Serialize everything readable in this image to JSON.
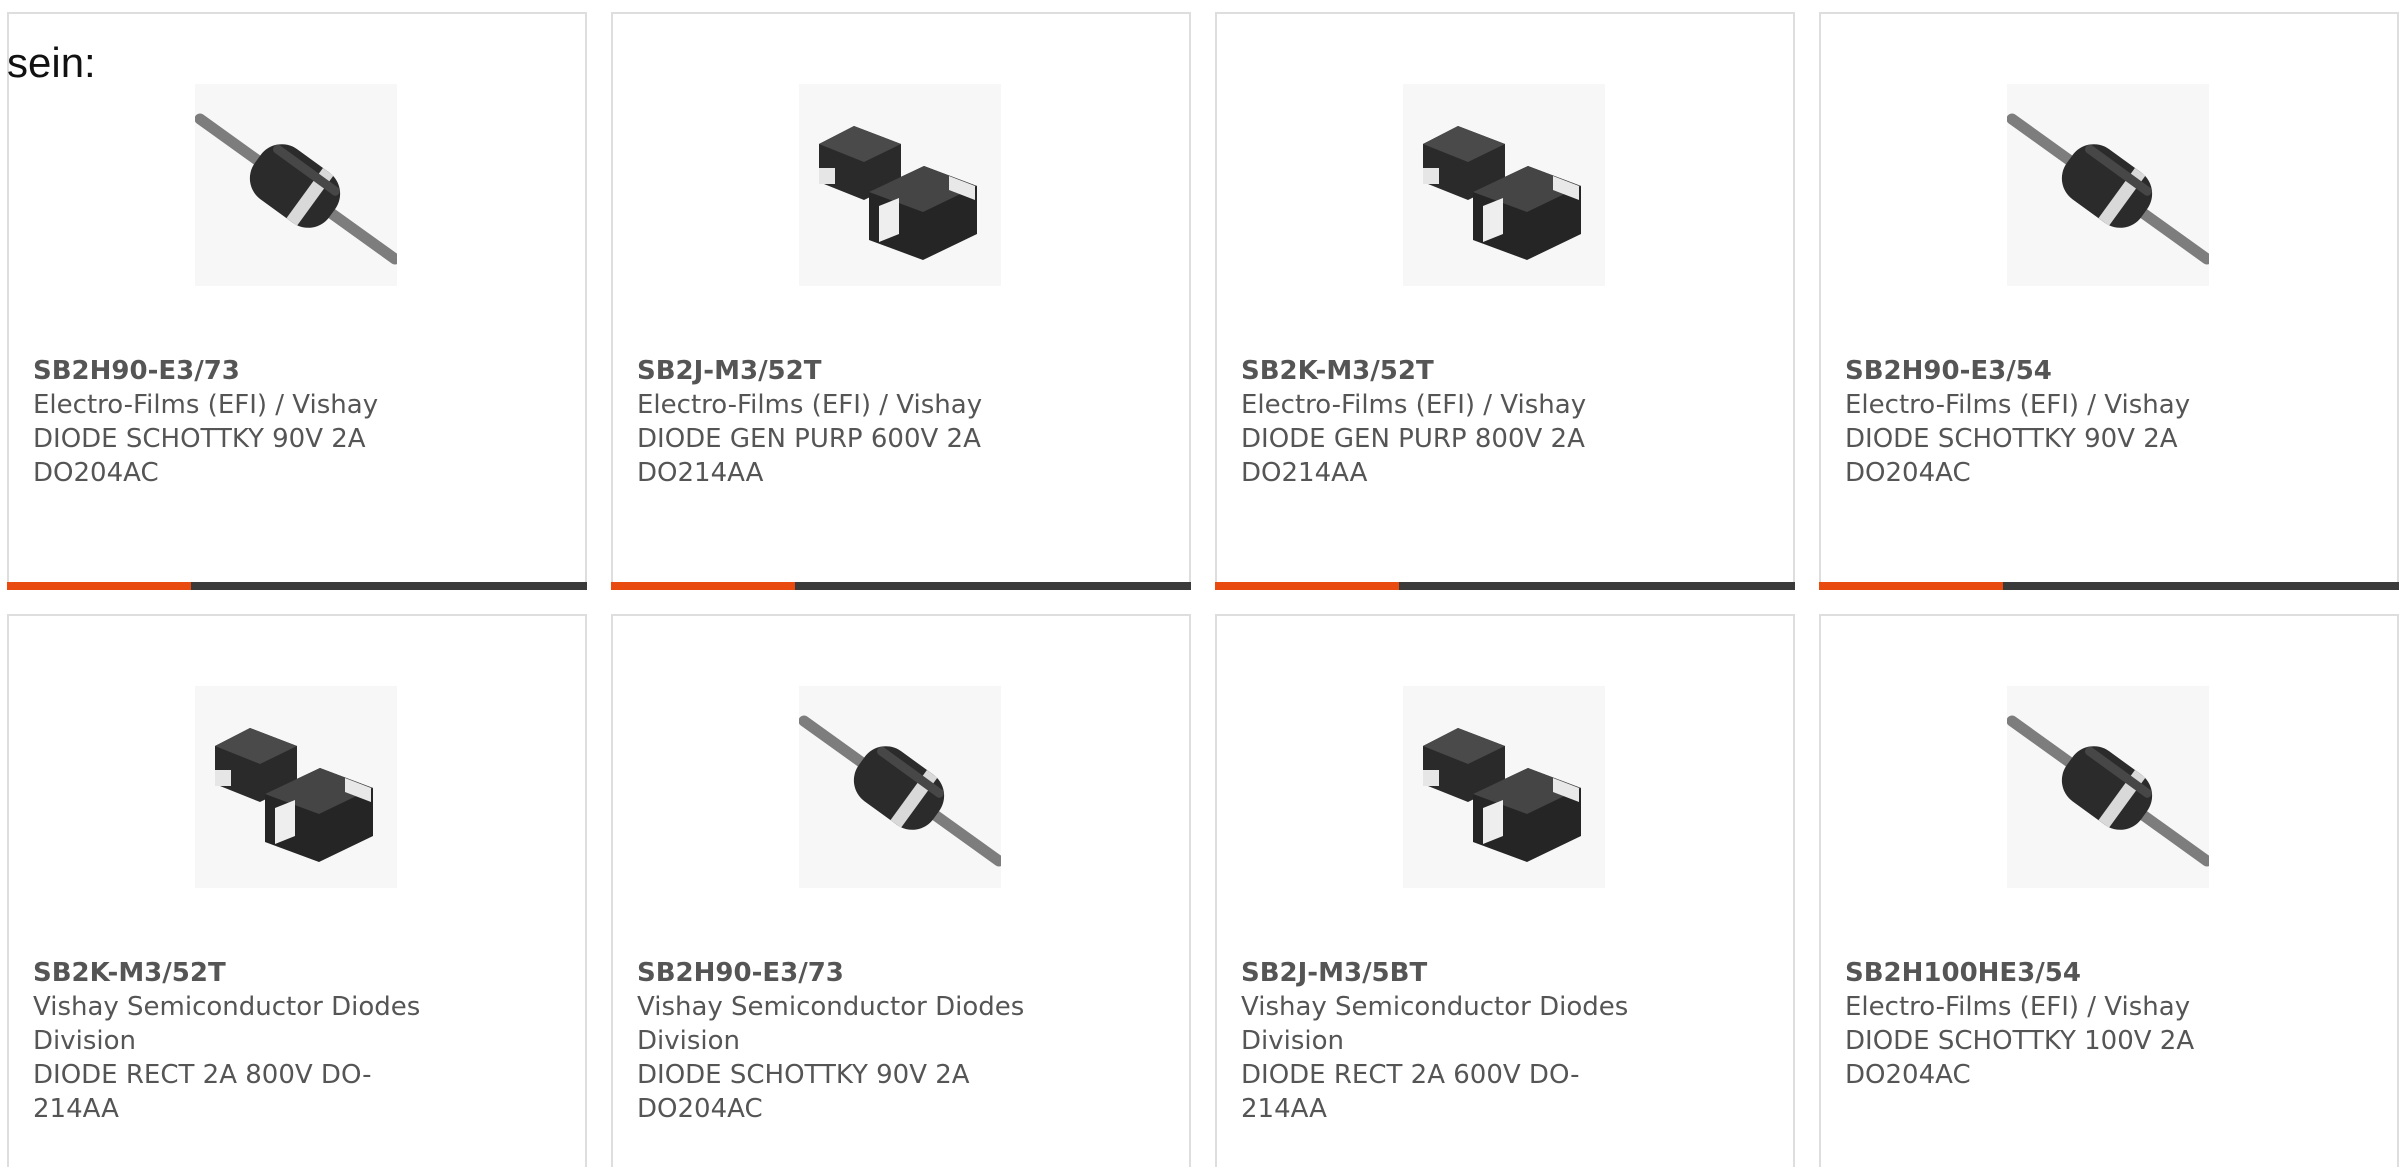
{
  "intro_text": "sein:",
  "colors": {
    "accent": "#e84a0f",
    "bar": "#3a3a3a",
    "border": "#dedede",
    "text": "#555555"
  },
  "products": [
    {
      "part": "SB2H90-E3/73",
      "manufacturer_line1": "Electro-Films (EFI) / Vishay",
      "manufacturer_line2": "",
      "desc_line1": "DIODE SCHOTTKY 90V 2A",
      "desc_line2": "DO204AC",
      "icon": "axial-diode-icon"
    },
    {
      "part": "SB2J-M3/52T",
      "manufacturer_line1": "Electro-Films (EFI) / Vishay",
      "manufacturer_line2": "",
      "desc_line1": "DIODE GEN PURP 600V 2A",
      "desc_line2": "DO214AA",
      "icon": "smd-diode-icon"
    },
    {
      "part": "SB2K-M3/52T",
      "manufacturer_line1": "Electro-Films (EFI) / Vishay",
      "manufacturer_line2": "",
      "desc_line1": "DIODE GEN PURP 800V 2A",
      "desc_line2": "DO214AA",
      "icon": "smd-diode-icon"
    },
    {
      "part": "SB2H90-E3/54",
      "manufacturer_line1": "Electro-Films (EFI) / Vishay",
      "manufacturer_line2": "",
      "desc_line1": "DIODE SCHOTTKY 90V 2A",
      "desc_line2": "DO204AC",
      "icon": "axial-diode-icon"
    },
    {
      "part": "SB2K-M3/52T",
      "manufacturer_line1": "Vishay Semiconductor Diodes",
      "manufacturer_line2": "Division",
      "desc_line1": "DIODE RECT 2A 800V DO-214AA",
      "desc_line2": "",
      "icon": "smd-diode-icon"
    },
    {
      "part": "SB2H90-E3/73",
      "manufacturer_line1": "Vishay Semiconductor Diodes",
      "manufacturer_line2": "Division",
      "desc_line1": "DIODE SCHOTTKY 90V 2A",
      "desc_line2": "DO204AC",
      "icon": "axial-diode-icon"
    },
    {
      "part": "SB2J-M3/5BT",
      "manufacturer_line1": "Vishay Semiconductor Diodes",
      "manufacturer_line2": "Division",
      "desc_line1": "DIODE RECT 2A 600V DO-214AA",
      "desc_line2": "",
      "icon": "smd-diode-icon"
    },
    {
      "part": "SB2H100HE3/54",
      "manufacturer_line1": "Electro-Films (EFI) / Vishay",
      "manufacturer_line2": "",
      "desc_line1": "DIODE SCHOTTKY 100V 2A",
      "desc_line2": "DO204AC",
      "icon": "axial-diode-icon"
    }
  ]
}
